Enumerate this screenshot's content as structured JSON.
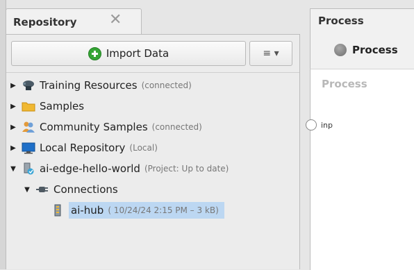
{
  "repository": {
    "tab_title": "Repository",
    "close_glyph": "✕",
    "import_label": "Import Data",
    "menu_glyph": "≡ ▾",
    "tree": [
      {
        "label": "Training Resources",
        "meta": "(connected)",
        "icon": "cloud-server-icon",
        "expanded": false
      },
      {
        "label": "Samples",
        "meta": "",
        "icon": "folder-icon",
        "expanded": false
      },
      {
        "label": "Community Samples",
        "meta": "(connected)",
        "icon": "users-icon",
        "expanded": false
      },
      {
        "label": "Local Repository",
        "meta": "(Local)",
        "icon": "monitor-icon",
        "expanded": false
      },
      {
        "label": "ai-edge-hello-world",
        "meta": "(Project: Up to date)",
        "icon": "project-icon",
        "expanded": true
      },
      {
        "label": "Connections",
        "meta": "",
        "icon": "plug-icon",
        "expanded": true
      },
      {
        "label": "ai-hub",
        "meta": "( 10/24/24 2:15 PM – 3 kB)",
        "icon": "connection-file-icon",
        "selected": true
      }
    ]
  },
  "process": {
    "header_title": "Process",
    "root_label": "Process",
    "canvas_label": "Process",
    "port_label": "inp"
  },
  "colors": {
    "selection": "#bcd7f2",
    "plus": "#35a535",
    "folder": "#f0b832",
    "monitor": "#1e6fc8"
  }
}
